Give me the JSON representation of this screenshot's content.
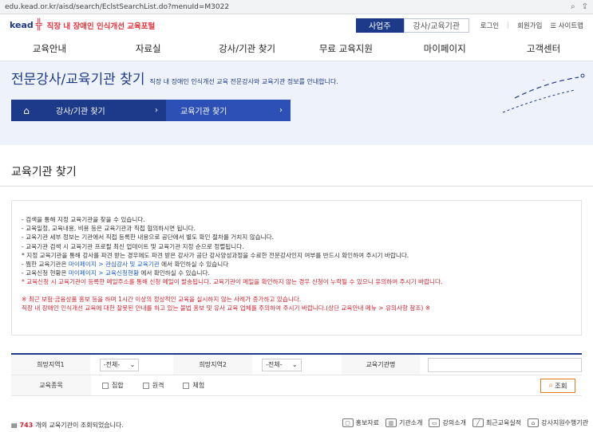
{
  "browser": {
    "url": "edu.kead.or.kr/aisd/search/EclstSearchList.do?menuId=M3022"
  },
  "header": {
    "logo_text": "kead",
    "logo_subtitle": "직장 내 장애인 인식개선 교육포털",
    "segment_active": "사업주",
    "segment_inactive": "강사/교육기관",
    "login": "로그인",
    "signup": "회원가입",
    "sitemap": "사이트맵"
  },
  "gnb": [
    "교육안내",
    "자료실",
    "강사/기관 찾기",
    "무료 교육지원",
    "마이페이지",
    "고객센터"
  ],
  "hero": {
    "title": "전문강사/교육기관 찾기",
    "description": "직장 내 장애인 인식개선 교육 전문강사와 교육기관 정보를 안내합니다.",
    "breadcrumb1": "강사/기관 찾기",
    "breadcrumb2": "교육기관 찾기"
  },
  "page_title": "교육기관 찾기",
  "notice": {
    "l1": "- 검색을 통해 지정 교육기관을 찾을 수 있습니다.",
    "l2": "- 교육일정, 교육내용, 비용 등은 교육기관과 직접 협의하시면 됩니다.",
    "l3": "- 교육기관 세부 정보는 기관에서 직접 등록한 내용으로 공단에서 별도 확인 절차를 거치지 않습니다.",
    "l4": "- 교육기관 검색 시 교육기관 프로필 최신 업데이트 및 교육기관 지정 순으로 정렬됩니다.",
    "l5": "* 지정 교육기관을 통해 강사를 파견 받는 경우에도 파견 받은 강사가 공단 강사양성과정을 수료한 전문강사인지 여부를 반드시 확인하여 주시기 바랍니다.",
    "l6a": "- 찜한 교육기관은 ",
    "l6b": "마이페이지 > 관심강사 및 교육기관",
    "l6c": " 에서 확인하실 수 있습니다",
    "l7a": "- 교육신청 현황은 ",
    "l7b": "마이페이지 > 교육신청현황",
    "l7c": " 에서 확인하실 수 있습니다.",
    "l8": "* 교육신청 시 교육기관이 등록한 메일주소를 통해 신청 메일이 발송됩니다. 교육기관이 메일을 확인하지 않는 경우 신청이 누락될 수 있으니 유의하여 주시기 바랍니다.",
    "l9": "※ 최근 보험·금융상품 홍보 등을 하며 1시간 이상의 정상적인 교육을 실시하지 않는 사례가 증가하고 있습니다.",
    "l10": "직장 내 장애인 인식개선 교육에 대한 잘못된 안내를 하고 있는 불법 홍보 및 유사 교육 업체를 주의하여 주시기 바랍니다.(상단 교육안내 메뉴 > 유의사항 참조) ※"
  },
  "search": {
    "region1_label": "희망지역1",
    "region1_value": "-전체-",
    "region2_label": "희망지역2",
    "region2_value": "-전체-",
    "org_label": "교육기관명",
    "org_value": "",
    "type_label": "교육종목",
    "opt1": "집합",
    "opt2": "원격",
    "opt3": "체험",
    "query_button": "조회"
  },
  "result": {
    "count": "743",
    "suffix": "개의 교육기관이 조회되었습니다."
  },
  "quick": [
    "홍보자료",
    "기관소개",
    "강의소개",
    "최근교육실적",
    "강사지원수행기관"
  ]
}
